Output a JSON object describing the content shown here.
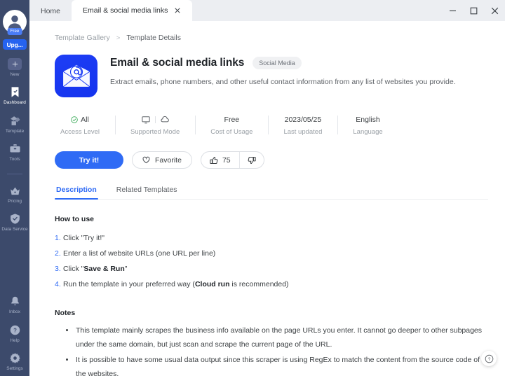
{
  "window": {
    "tabs": [
      {
        "label": "Home",
        "active": false,
        "closable": false
      },
      {
        "label": "Email & social media links",
        "active": true,
        "closable": true
      }
    ],
    "controls": {
      "minimize": "minimize-icon",
      "maximize": "maximize-icon",
      "close": "close-icon"
    }
  },
  "sidebar": {
    "account": {
      "plan_badge": "Free",
      "upgrade_label": "Upg...",
      "avatar_icon": "user-avatar-icon"
    },
    "items": [
      {
        "label": "New",
        "icon": "plus-icon",
        "active": false
      },
      {
        "label": "Dashboard",
        "icon": "bookmark-check-icon",
        "active": true
      },
      {
        "label": "Template",
        "icon": "template-layers-icon",
        "active": false
      },
      {
        "label": "Tools",
        "icon": "toolbox-icon",
        "active": false
      },
      {
        "label": "Pricing",
        "icon": "crown-icon",
        "active": false
      },
      {
        "label": "Data Service",
        "icon": "shield-check-icon",
        "active": false
      }
    ],
    "bottom_items": [
      {
        "label": "Inbox",
        "icon": "bell-icon"
      },
      {
        "label": "Help",
        "icon": "question-circle-icon"
      },
      {
        "label": "Settings",
        "icon": "gear-icon"
      }
    ]
  },
  "breadcrumb": {
    "root": "Template Gallery",
    "separator": ">",
    "current": "Template Details"
  },
  "template": {
    "icon": "email-at-envelope-icon",
    "title": "Email & social media links",
    "tag": "Social Media",
    "description": "Extract emails, phone numbers, and other useful contact information from any list of websites you provide."
  },
  "stats": [
    {
      "value": "All",
      "label": "Access Level",
      "icon": "check-circle-icon"
    },
    {
      "value": "",
      "label": "Supported Mode",
      "icons": [
        "monitor-icon",
        "cloud-icon"
      ]
    },
    {
      "value": "Free",
      "label": "Cost of Usage"
    },
    {
      "value": "2023/05/25",
      "label": "Last updated"
    },
    {
      "value": "English",
      "label": "Language"
    }
  ],
  "actions": {
    "try_label": "Try it!",
    "favorite_label": "Favorite",
    "upvote_count": "75",
    "thumbs_up_icon": "thumbs-up-icon",
    "thumbs_down_icon": "thumbs-down-icon"
  },
  "content_tabs": [
    {
      "label": "Description",
      "active": true
    },
    {
      "label": "Related Templates",
      "active": false
    }
  ],
  "how_to_use": {
    "title": "How to use",
    "steps": [
      {
        "num": "1.",
        "html": "Click \"Try it!\""
      },
      {
        "num": "2.",
        "html": "Enter a list of website URLs (one URL per line)"
      },
      {
        "num": "3.",
        "html": "Click \"<b>Save &amp; Run</b>\""
      },
      {
        "num": "4.",
        "html": "Run the template in your preferred way (<b>Cloud run</b> is recommended)"
      }
    ]
  },
  "notes": {
    "title": "Notes",
    "items": [
      "This template mainly scrapes the business info available on the page URLs you enter. It cannot go deeper to other subpages under the same domain, but just scan and scrape the current page of the URL.",
      "It is possible to have some usual data output since this scraper is using RegEx to match the content from the source code of the websites."
    ]
  },
  "help_fab": {
    "icon": "question-circle-icon"
  },
  "colors": {
    "sidebar_bg": "#3c4a6b",
    "accent": "#2f6bf5",
    "brand_icon_bg": "#1e3ef5",
    "ok_green": "#34a853",
    "chrome_bg": "#eceef2"
  }
}
